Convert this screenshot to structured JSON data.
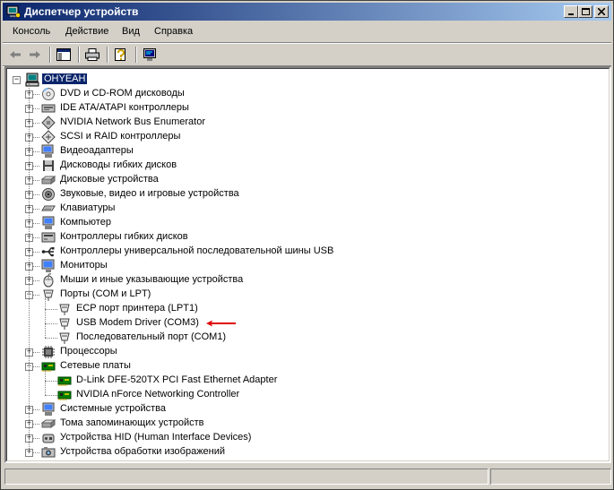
{
  "window": {
    "title": "Диспетчер устройств"
  },
  "menu": [
    "Консоль",
    "Действие",
    "Вид",
    "Справка"
  ],
  "toolbar": [
    "back-icon",
    "forward-icon",
    "console-tree-icon",
    "print-icon",
    "help-icon",
    "scan-hardware-icon"
  ],
  "tree": {
    "root": "OHYEAH",
    "categories": [
      {
        "label": "DVD и CD-ROM дисководы",
        "icon": "cdrom-icon"
      },
      {
        "label": "IDE ATA/ATAPI контроллеры",
        "icon": "ide-icon"
      },
      {
        "label": "NVIDIA Network Bus Enumerator",
        "icon": "enum-icon"
      },
      {
        "label": "SCSI и RAID контроллеры",
        "icon": "scsi-icon"
      },
      {
        "label": "Видеоадаптеры",
        "icon": "display-icon"
      },
      {
        "label": "Дисководы гибких дисков",
        "icon": "floppy-icon"
      },
      {
        "label": "Дисковые устройства",
        "icon": "disk-icon"
      },
      {
        "label": "Звуковые, видео и игровые устройства",
        "icon": "sound-icon"
      },
      {
        "label": "Клавиатуры",
        "icon": "keyboard-icon"
      },
      {
        "label": "Компьютер",
        "icon": "computer-icon"
      },
      {
        "label": "Контроллеры гибких дисков",
        "icon": "fdc-icon"
      },
      {
        "label": "Контроллеры универсальной последовательной шины USB",
        "icon": "usb-icon"
      },
      {
        "label": "Мониторы",
        "icon": "monitor-icon"
      },
      {
        "label": "Мыши и иные указывающие устройства",
        "icon": "mouse-icon"
      },
      {
        "label": "Порты (COM и LPT)",
        "icon": "port-icon",
        "expanded": true,
        "children": [
          {
            "label": "ECP порт принтера (LPT1)",
            "icon": "port-icon"
          },
          {
            "label": "USB Modem Driver (COM3)",
            "icon": "port-icon"
          },
          {
            "label": "Последовательный порт (COM1)",
            "icon": "port-icon"
          }
        ]
      },
      {
        "label": "Процессоры",
        "icon": "cpu-icon"
      },
      {
        "label": "Сетевые платы",
        "icon": "network-icon",
        "expanded": true,
        "children": [
          {
            "label": "D-Link DFE-520TX PCI Fast Ethernet Adapter",
            "icon": "network-icon"
          },
          {
            "label": "NVIDIA nForce Networking Controller",
            "icon": "network-icon"
          }
        ]
      },
      {
        "label": "Системные устройства",
        "icon": "system-icon"
      },
      {
        "label": "Тома запоминающих устройств",
        "icon": "volume-icon"
      },
      {
        "label": "Устройства HID (Human Interface Devices)",
        "icon": "hid-icon"
      },
      {
        "label": "Устройства обработки изображений",
        "icon": "imaging-icon"
      }
    ]
  },
  "annotation": {
    "target": "USB Modem Driver (COM3)",
    "color": "#e00000"
  },
  "colors": {
    "titlebar_start": "#0a246a",
    "titlebar_end": "#a6caf0",
    "selection": "#0a246a"
  }
}
